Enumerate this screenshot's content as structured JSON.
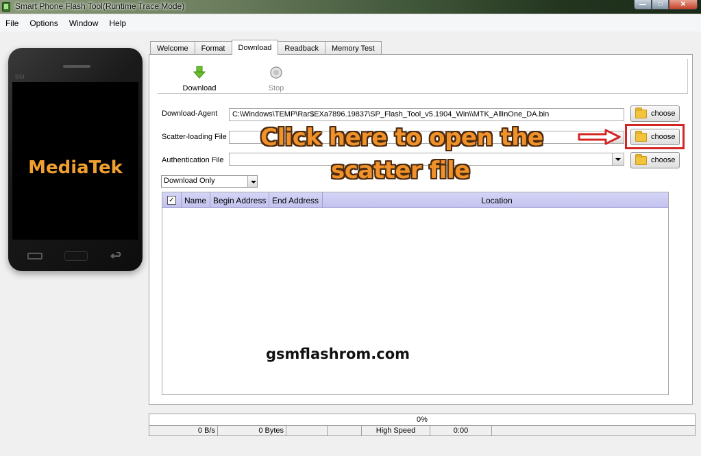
{
  "window": {
    "title": "Smart Phone Flash Tool(Runtime Trace Mode)",
    "min_glyph": "—",
    "max_glyph": "□",
    "close_glyph": "✕"
  },
  "menu": [
    "File",
    "Options",
    "Window",
    "Help"
  ],
  "phone": {
    "bm_text": "BM",
    "brand": "MediaTek"
  },
  "tabs": [
    "Welcome",
    "Format",
    "Download",
    "Readback",
    "Memory Test"
  ],
  "active_tab": "Download",
  "toolbar": {
    "download_label": "Download",
    "stop_label": "Stop"
  },
  "download_agent": {
    "label": "Download-Agent",
    "value": "C:\\Windows\\TEMP\\Rar$EXa7896.19837\\SP_Flash_Tool_v5.1904_Win\\\\MTK_AllInOne_DA.bin"
  },
  "scatter_file": {
    "label": "Scatter-loading File",
    "value": ""
  },
  "auth_file": {
    "label": "Authentication File",
    "value": ""
  },
  "choose_label": "choose",
  "mode_select": {
    "value": "Download Only"
  },
  "table": {
    "check": "✓",
    "columns": [
      "Name",
      "Begin Address",
      "End Address",
      "Location"
    ],
    "rows": []
  },
  "annotation": {
    "line1": "Click here to open the",
    "line2": "scatter file"
  },
  "watermark": "gsmflashrom.com",
  "progress": {
    "text": "0%",
    "value": 0
  },
  "status": {
    "speed": "0 B/s",
    "bytes": "0 Bytes",
    "usb": "High Speed",
    "time": "0:00"
  },
  "colors": {
    "annotation_text": "#f0912a",
    "highlight": "#d42424",
    "table_header": "#c8c8f2"
  }
}
